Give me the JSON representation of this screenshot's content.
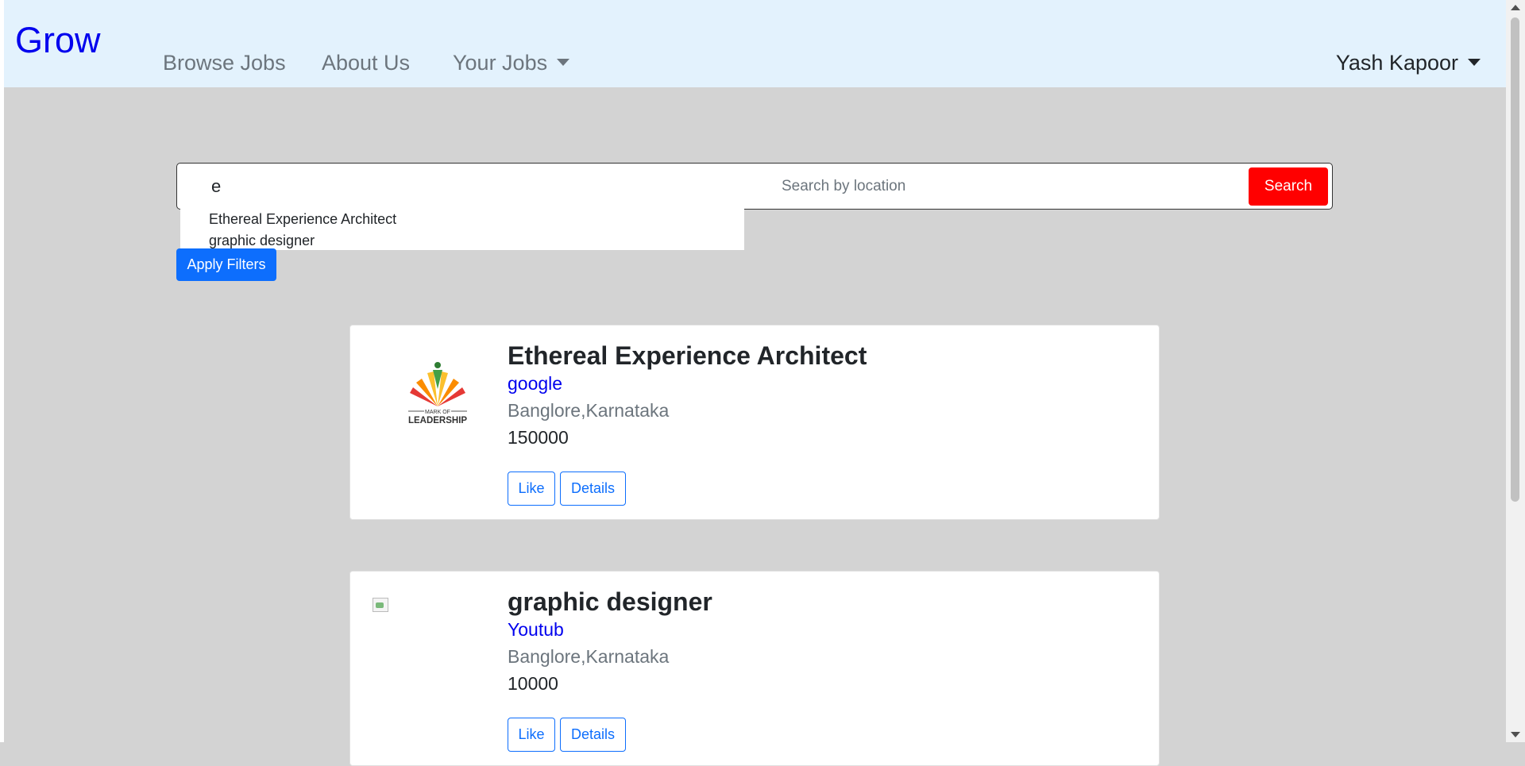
{
  "navbar": {
    "brand": "Grow",
    "links": [
      "Browse Jobs",
      "About Us",
      "Your Jobs"
    ],
    "user": "Yash Kapoor"
  },
  "search": {
    "keyword_value": "e",
    "location_placeholder": "Search by location",
    "search_button": "Search",
    "suggestions": [
      "Ethereal Experience Architect",
      "graphic designer"
    ],
    "apply_filters": "Apply Filters"
  },
  "jobs": [
    {
      "title": "Ethereal Experience Architect",
      "company": "google",
      "location": "Banglore,Karnataka",
      "salary": "150000",
      "logo_text_top": "MARK OF",
      "logo_text_bottom": "LEADERSHIP",
      "like_label": "Like",
      "details_label": "Details"
    },
    {
      "title": "graphic designer",
      "company": "Youtub",
      "location": "Banglore,Karnataka",
      "salary": "10000",
      "like_label": "Like",
      "details_label": "Details"
    }
  ],
  "colors": {
    "navbar_bg": "#e3f2fd",
    "page_bg": "#d3d3d3",
    "brand": "#0000ee",
    "search_button": "#ff0000",
    "primary": "#0d6efd"
  }
}
